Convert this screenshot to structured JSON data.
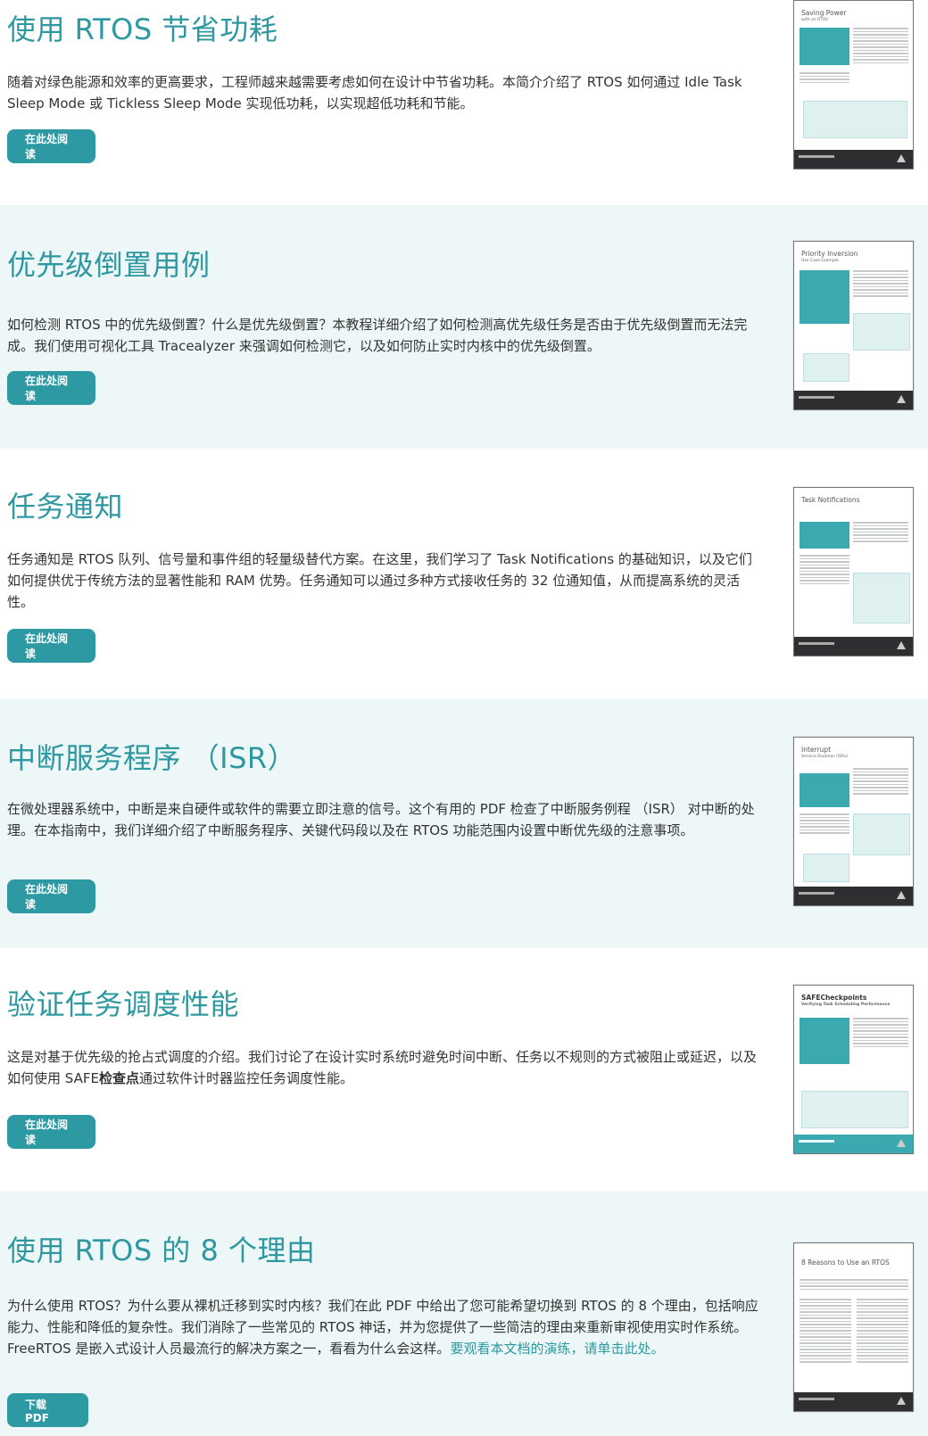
{
  "articles": [
    {
      "title": "使用 RTOS 节省功耗",
      "description": "随着对绿色能源和效率的更高要求，工程师越来越需要考虑如何在设计中节省功耗。本简介介绍了 RTOS 如何通过 Idle Task Sleep Mode 或 Tickless Sleep Mode 实现低功耗，以实现超低功耗和节能。",
      "button": "在此处阅读",
      "thumb_title": "Saving Power",
      "thumb_sub": "with an RTOS"
    },
    {
      "title": "优先级倒置用例",
      "description": "如何检测 RTOS 中的优先级倒置？什么是优先级倒置？本教程详细介绍了如何检测高优先级任务是否由于优先级倒置而无法完成。我们使用可视化工具 Tracealyzer 来强调如何检测它，以及如何防止实时内核中的优先级倒置。",
      "button": "在此处阅读",
      "thumb_title": "Priority Inversion",
      "thumb_sub": "Use Case Example"
    },
    {
      "title": "任务通知",
      "description": "任务通知是 RTOS 队列、信号量和事件组的轻量级替代方案。在这里，我们学习了 Task Notifications 的基础知识，以及它们如何提供优于传统方法的显著性能和 RAM 优势。任务通知可以通过多种方式接收任务的 32 位通知值，从而提高系统的灵活性。",
      "button": "在此处阅读",
      "thumb_title": "Task Notifications",
      "thumb_sub": ""
    },
    {
      "title": "中断服务程序 （ISR）",
      "description": "在微处理器系统中，中断是来自硬件或软件的需要立即注意的信号。这个有用的 PDF 检查了中断服务例程 （ISR） 对中断的处理。在本指南中，我们详细介绍了中断服务程序、关键代码段以及在 RTOS 功能范围内设置中断优先级的注意事项。",
      "button": "在此处阅读",
      "thumb_title": "Interrupt",
      "thumb_sub": "Service Routines (ISRs)"
    },
    {
      "title": "验证任务调度性能",
      "description_pre": "这是对基于优先级的抢占式调度的介绍。我们讨论了在设计实时系统时避免时间中断、任务以不规则的方式被阻止或延迟，以及如何使用 SAFE",
      "description_bold": "检查点",
      "description_post": "通过软件计时器监控任务调度性能。",
      "button": "在此处阅读",
      "thumb_title": "SAFECheckpoints",
      "thumb_sub": "Verifying Task Scheduling Performance"
    },
    {
      "title": "使用 RTOS 的 8 个理由",
      "description_pre": "为什么使用 RTOS？为什么要从裸机迁移到实时内核？我们在此 PDF 中给出了您可能希望切换到 RTOS 的 8 个理由，包括响应能力、性能和降低的复杂性。我们消除了一些常见的 RTOS 神话，并为您提供了一些简洁的理由来重新审视使用实时作系统。FreeRTOS 是嵌入式设计人员最流行的解决方案之一，看看为什么会这样。",
      "description_link": "要观看本文档的演练，请单击此处。",
      "button": "下载 PDF",
      "thumb_title": "8 Reasons to Use an RTOS",
      "thumb_sub": ""
    }
  ]
}
